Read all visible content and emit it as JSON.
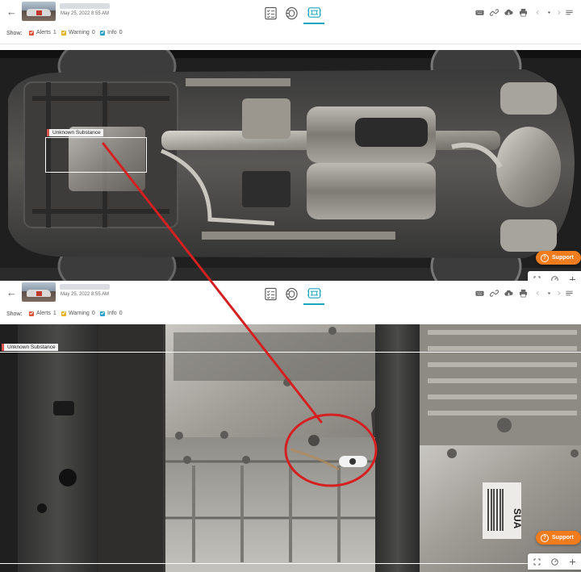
{
  "panels": [
    {
      "id": "overview",
      "header": {
        "date": "May 25, 2022 8:55 AM"
      },
      "filters": {
        "show_label": "Show:",
        "items": [
          {
            "label": "Alerts",
            "count": "1",
            "color": "#e0553a"
          },
          {
            "label": "Warning",
            "count": "0",
            "color": "#e6b422"
          },
          {
            "label": "Info",
            "count": "0",
            "color": "#2aa0cc"
          }
        ]
      },
      "alert_label": "Unknown Substance",
      "support_label": "Support",
      "view_tabs": [
        "checklist-icon",
        "tire-icon",
        "undercarriage-icon"
      ],
      "active_tab": "undercarriage-icon"
    },
    {
      "id": "zoomed",
      "header": {
        "date": "May 25, 2022 8:55 AM"
      },
      "filters": {
        "show_label": "Show:",
        "items": [
          {
            "label": "Alerts",
            "count": "1",
            "color": "#e0553a"
          },
          {
            "label": "Warning",
            "count": "0",
            "color": "#e6b422"
          },
          {
            "label": "Info",
            "count": "0",
            "color": "#2aa0cc"
          }
        ]
      },
      "alert_label": "Unknown Substance",
      "support_label": "Support",
      "view_tabs": [
        "checklist-icon",
        "tire-icon",
        "undercarriage-icon"
      ],
      "active_tab": "undercarriage-icon"
    }
  ],
  "tools": [
    "keyboard-icon",
    "link-icon",
    "cloud-download-icon",
    "print-icon",
    "prev-arrow-icon",
    "dropdown-icon",
    "next-arrow-icon",
    "menu-icon"
  ],
  "zoom_controls": [
    "fit-icon",
    "gauge-icon",
    "zoom-in-icon"
  ],
  "colors": {
    "accent": "#1ba6bf",
    "support": "#f07c1e",
    "annotation": "#d42020"
  }
}
